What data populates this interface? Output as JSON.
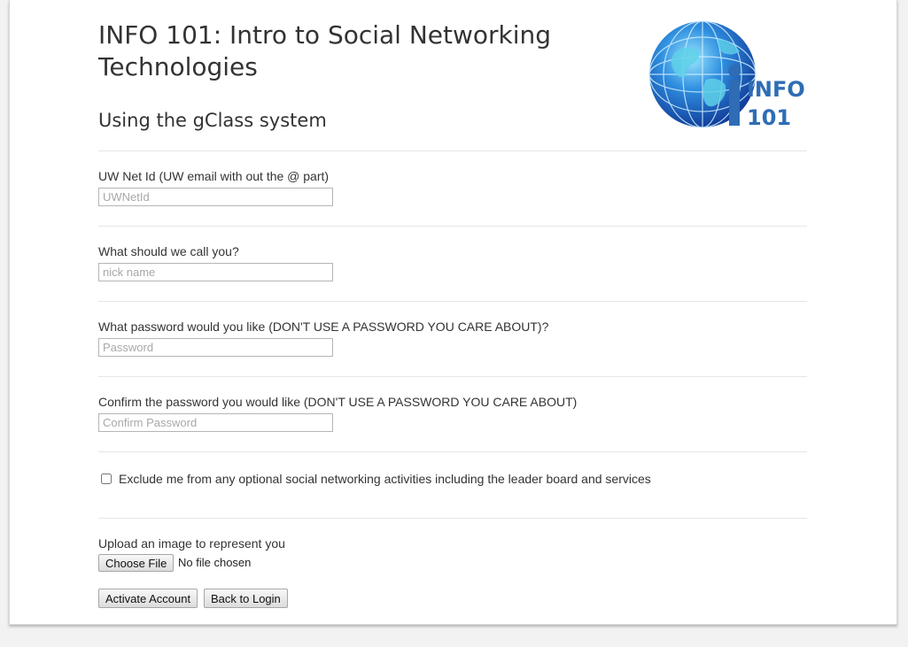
{
  "header": {
    "title": "INFO 101: Intro to Social Networking Technologies",
    "subtitle": "Using the gClass system",
    "logo": {
      "line1": "INFO",
      "line2": "101",
      "icon": "globe-icon"
    }
  },
  "form": {
    "netid": {
      "label": "UW Net Id (UW email with out the @ part)",
      "placeholder": "UWNetId",
      "value": ""
    },
    "nickname": {
      "label": "What should we call you?",
      "placeholder": "nick name",
      "value": ""
    },
    "password": {
      "label": "What password would you like (DON'T USE A PASSWORD YOU CARE ABOUT)?",
      "placeholder": "Password",
      "value": ""
    },
    "confirm": {
      "label": "Confirm the password you would like (DON'T USE A PASSWORD YOU CARE ABOUT)",
      "placeholder": "Confirm Password",
      "value": ""
    },
    "exclude": {
      "label": "Exclude me from any optional social networking activities including the leader board and services",
      "checked": false
    },
    "upload": {
      "label": "Upload an image to represent you",
      "button": "Choose File",
      "status": "No file chosen"
    },
    "buttons": {
      "activate": "Activate Account",
      "back": "Back to Login"
    }
  },
  "colors": {
    "background": "#f2f2f2",
    "card": "#ffffff",
    "text": "#333333",
    "logo_text": "#2e6db5"
  }
}
